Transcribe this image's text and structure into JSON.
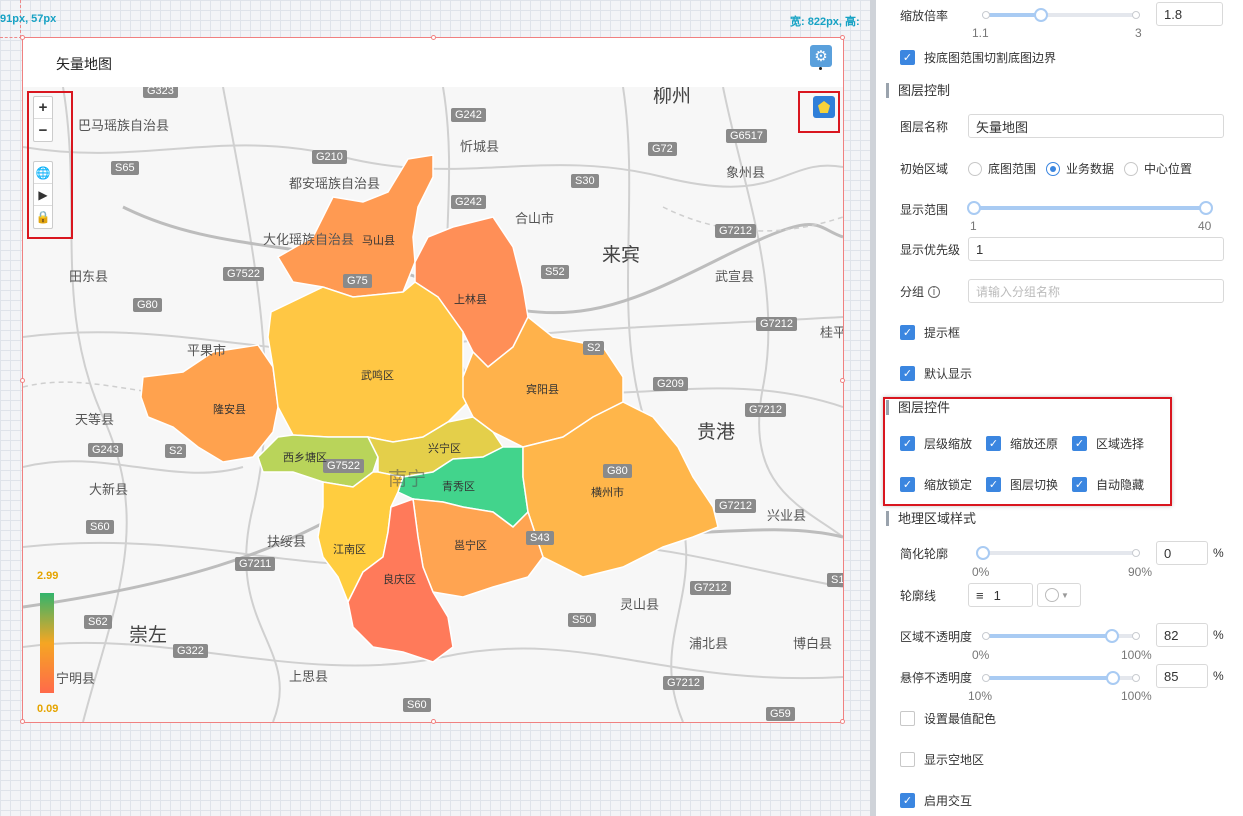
{
  "canvas": {
    "coord_left": "91px, 57px",
    "coord_right": "宽: 822px, 高:"
  },
  "widget": {
    "title": "矢量地图",
    "zoom_in": "+",
    "zoom_out": "−",
    "legend": {
      "max": "2.99",
      "min": "0.09"
    }
  },
  "map": {
    "regions": [
      {
        "name": "马山县",
        "color": "#ff9a52"
      },
      {
        "name": "上林县",
        "color": "#ff8f57"
      },
      {
        "name": "隆安县",
        "color": "#ffa24e"
      },
      {
        "name": "武鸣区",
        "color": "#ffc744"
      },
      {
        "name": "宾阳县",
        "color": "#ffb24b"
      },
      {
        "name": "西乡塘区",
        "color": "#b9d45a"
      },
      {
        "name": "兴宁区",
        "color": "#e4cf4a"
      },
      {
        "name": "青秀区",
        "color": "#42d48c"
      },
      {
        "name": "横州市",
        "color": "#ffb64a"
      },
      {
        "name": "江南区",
        "color": "#ffcd3f"
      },
      {
        "name": "邕宁区",
        "color": "#ffa451"
      },
      {
        "name": "良庆区",
        "color": "#ff7a5a"
      }
    ],
    "road_labels": [
      "G323",
      "G242",
      "G72",
      "G6517",
      "G210",
      "S65",
      "G242",
      "S30",
      "G7212",
      "G7522",
      "G75",
      "S52",
      "S2",
      "G80",
      "G209",
      "G7212",
      "G7212",
      "S2",
      "G243",
      "G7522",
      "S60",
      "G7211",
      "G7212",
      "S43",
      "G80",
      "S62",
      "G322",
      "S50",
      "G7212",
      "G7212",
      "S60",
      "G59",
      "S1"
    ],
    "places": [
      "柳州",
      "巴马瑶族自治县",
      "忻城县",
      "象州县",
      "都安瑶族自治县",
      "合山市",
      "大化瑶族自治县",
      "来宾",
      "武宣县",
      "田东县",
      "平果市",
      "桂平",
      "天等县",
      "贵港",
      "大新县",
      "兴业县",
      "扶绥县",
      "崇左",
      "灵山县",
      "浦北县",
      "博白县",
      "上思县",
      "宁明县",
      "南宁"
    ]
  },
  "panel": {
    "zoom_ratio": {
      "label": "缩放倍率",
      "value": "1.8",
      "min": "1.1",
      "max": "3",
      "fraction": 0.37
    },
    "crop_bounds": {
      "label": "按底图范围切割底图边界",
      "checked": true
    },
    "layer_control": {
      "title": "图层控制",
      "name_label": "图层名称",
      "name_value": "矢量地图",
      "initial_region_label": "初始区域",
      "initial_region_options": [
        "底图范围",
        "业务数据",
        "中心位置"
      ],
      "initial_region_selected": "业务数据",
      "display_range_label": "显示范围",
      "display_range_min": "1",
      "display_range_max": "40",
      "priority_label": "显示优先级",
      "priority_value": "1",
      "group_label": "分组",
      "group_placeholder": "请输入分组名称",
      "tooltip_label": "提示框",
      "default_show_label": "默认显示"
    },
    "layer_widgets": {
      "title": "图层控件",
      "items": [
        {
          "label": "层级缩放",
          "checked": true
        },
        {
          "label": "缩放还原",
          "checked": true
        },
        {
          "label": "区域选择",
          "checked": true
        },
        {
          "label": "缩放锁定",
          "checked": true
        },
        {
          "label": "图层切换",
          "checked": true
        },
        {
          "label": "自动隐藏",
          "checked": true
        }
      ]
    },
    "geo_style": {
      "title": "地理区域样式",
      "simplify_label": "简化轮廓",
      "simplify_value": "0",
      "simplify_min": "0%",
      "simplify_max": "90%",
      "simplify_fraction": 0,
      "outline_label": "轮廓线",
      "outline_value": "1",
      "region_opacity_label": "区域不透明度",
      "region_opacity_value": "82",
      "region_opacity_min": "0%",
      "region_opacity_max": "100%",
      "region_opacity_fraction": 0.82,
      "hover_opacity_label": "悬停不透明度",
      "hover_opacity_value": "85",
      "hover_opacity_min": "10%",
      "hover_opacity_max": "100%",
      "hover_opacity_fraction": 0.85,
      "unit": "%",
      "extreme_color_label": "设置最值配色",
      "empty_region_label": "显示空地区",
      "interaction_label": "启用交互"
    }
  }
}
